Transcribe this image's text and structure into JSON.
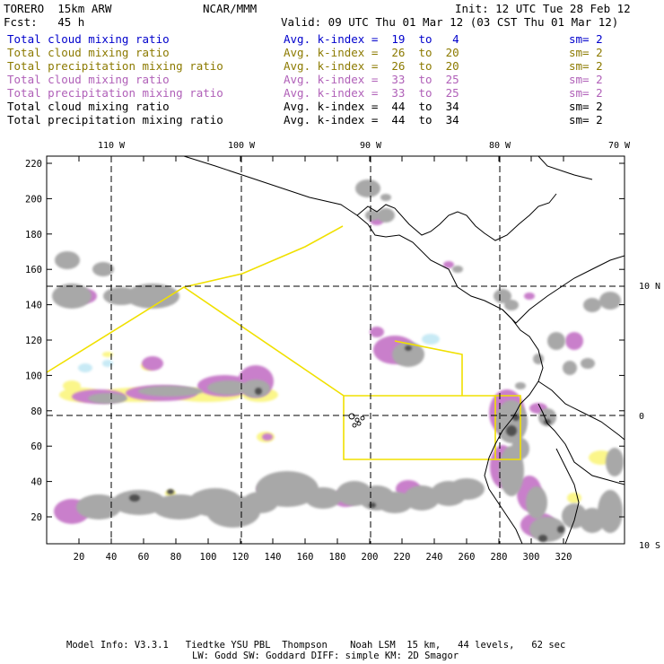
{
  "header": {
    "model": "TORERO  15km ARW",
    "org": "NCAR/MMM",
    "init": "Init: 12 UTC Tue 28 Feb 12",
    "fcst": "Fcst:   45 h",
    "valid": "Valid: 09 UTC Thu 01 Mar 12 (03 CST Thu 01 Mar 12)"
  },
  "legend": [
    {
      "field": "Total cloud mixing ratio",
      "kindex": "Avg. k-index =  19  to   4",
      "sm": "sm= 2",
      "color": "#0000cc"
    },
    {
      "field": "Total cloud mixing ratio",
      "kindex": "Avg. k-index =  26  to  20",
      "sm": "sm= 2",
      "color": "#8c7a00"
    },
    {
      "field": "Total precipitation mixing ratio",
      "kindex": "Avg. k-index =  26  to  20",
      "sm": "sm= 2",
      "color": "#8c7a00"
    },
    {
      "field": "Total cloud mixing ratio",
      "kindex": "Avg. k-index =  33  to  25",
      "sm": "sm= 2",
      "color": "#b060b8"
    },
    {
      "field": "Total precipitation mixing ratio",
      "kindex": "Avg. k-index =  33  to  25",
      "sm": "sm= 2",
      "color": "#b060b8"
    },
    {
      "field": "Total cloud mixing ratio",
      "kindex": "Avg. k-index =  44  to  34",
      "sm": "sm= 2",
      "color": "#000000"
    },
    {
      "field": "Total precipitation mixing ratio",
      "kindex": "Avg. k-index =  44  to  34",
      "sm": "sm= 2",
      "color": "#000000"
    }
  ],
  "map": {
    "lon_labels": [
      "110 W",
      "100 W",
      "90 W",
      "80 W",
      "70 W"
    ],
    "lat_labels": [
      "10 N",
      "0",
      "10 S"
    ],
    "x_ticks": [
      "20",
      "40",
      "60",
      "80",
      "100",
      "120",
      "140",
      "160",
      "180",
      "200",
      "220",
      "240",
      "260",
      "280",
      "300",
      "320"
    ],
    "y_ticks": [
      "220",
      "200",
      "180",
      "160",
      "140",
      "120",
      "100",
      "80",
      "60",
      "40",
      "20"
    ],
    "colors": {
      "blue_shade": "#c8eaf5",
      "yellow_shade": "#fbf68a",
      "magenta_shade": "#c97fcb",
      "gray_shade": "#a8a8a8",
      "dark_shade": "#505050",
      "domain_outline": "#f0e000",
      "coastline": "#000000"
    }
  },
  "footer": {
    "line1": "Model Info: V3.3.1   Tiedtke YSU PBL  Thompson    Noah LSM  15 km,   44 levels,   62 sec",
    "line2": "LW: Godd SW: Goddard DIFF: simple KM: 2D Smagor"
  }
}
